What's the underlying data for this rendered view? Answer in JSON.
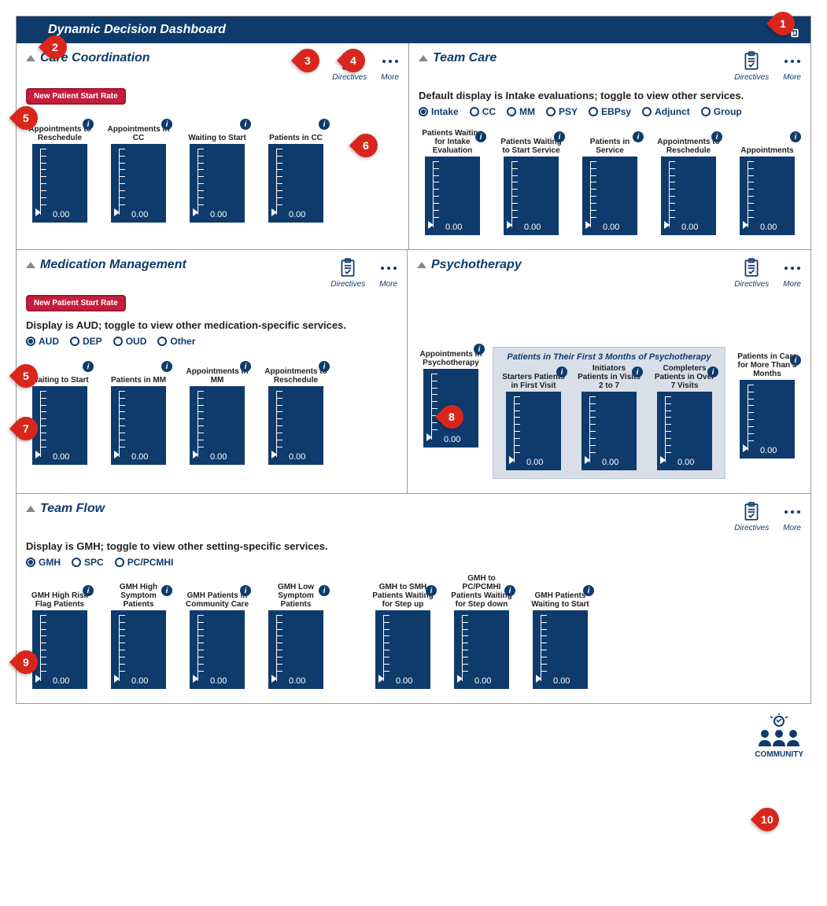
{
  "title": "Dynamic Decision Dashboard",
  "actions": {
    "directives": "Directives",
    "more": "More"
  },
  "callouts": [
    "1",
    "2",
    "3",
    "4",
    "5",
    "6",
    "7",
    "8",
    "9",
    "10"
  ],
  "community_label": "COMMUNITY",
  "panels": {
    "cc": {
      "title": "Care Coordination",
      "pill": "New Patient Start Rate",
      "gauges": [
        {
          "label": "Appointments to Reschedule",
          "value": "0.00"
        },
        {
          "label": "Appointments in CC",
          "value": "0.00"
        },
        {
          "label": "Waiting to Start",
          "value": "0.00"
        },
        {
          "label": "Patients in CC",
          "value": "0.00"
        }
      ]
    },
    "tc": {
      "title": "Team Care",
      "subtext": "Default display is Intake evaluations; toggle to view other services.",
      "radios": [
        "Intake",
        "CC",
        "MM",
        "PSY",
        "EBPsy",
        "Adjunct",
        "Group"
      ],
      "selected": "Intake",
      "gauges": [
        {
          "label": "Patients Waiting for Intake Evaluation",
          "value": "0.00"
        },
        {
          "label": "Patients Waiting to Start Service",
          "value": "0.00"
        },
        {
          "label": "Patients in Service",
          "value": "0.00"
        },
        {
          "label": "Appointments to Reschedule",
          "value": "0.00"
        },
        {
          "label": "Appointments",
          "value": "0.00"
        }
      ]
    },
    "mm": {
      "title": "Medication Management",
      "pill": "New Patient Start Rate",
      "subtext": "Display is AUD; toggle to view other medication-specific services.",
      "radios": [
        "AUD",
        "DEP",
        "OUD",
        "Other"
      ],
      "selected": "AUD",
      "gauges": [
        {
          "label": "Waiting to Start",
          "value": "0.00"
        },
        {
          "label": "Patients in MM",
          "value": "0.00"
        },
        {
          "label": "Appointments in MM",
          "value": "0.00"
        },
        {
          "label": "Appointments to Reschedule",
          "value": "0.00"
        }
      ]
    },
    "psy": {
      "title": "Psychotherapy",
      "highlight_title": "Patients in Their First 3 Months of Psychotherapy",
      "left_gauge": {
        "label": "Appointments in Psychotherapy",
        "value": "0.00"
      },
      "highlight_gauges": [
        {
          "label": "Starters Patients in First Visit",
          "value": "0.00"
        },
        {
          "label": "Initiators Patients in Visits 2 to 7",
          "value": "0.00"
        },
        {
          "label": "Completers Patients in Over 7 Visits",
          "value": "0.00"
        }
      ],
      "right_gauge": {
        "label": "Patients in Care for More Than 3 Months",
        "value": "0.00"
      }
    },
    "tf": {
      "title": "Team Flow",
      "subtext": "Display is GMH; toggle to view other setting-specific services.",
      "radios": [
        "GMH",
        "SPC",
        "PC/PCMHI"
      ],
      "selected": "GMH",
      "gauges_left": [
        {
          "label": "GMH High Risk Flag Patients",
          "value": "0.00"
        },
        {
          "label": "GMH High Symptom Patients",
          "value": "0.00"
        },
        {
          "label": "GMH Patients in Community Care",
          "value": "0.00"
        },
        {
          "label": "GMH Low Symptom Patients",
          "value": "0.00"
        }
      ],
      "gauges_right": [
        {
          "label": "GMH to SMH Patients Waiting for Step up",
          "value": "0.00"
        },
        {
          "label": "GMH to PC/PCMHI Patients Waiting for Step down",
          "value": "0.00"
        },
        {
          "label": "GMH Patients Waiting to Start",
          "value": "0.00"
        }
      ]
    }
  }
}
